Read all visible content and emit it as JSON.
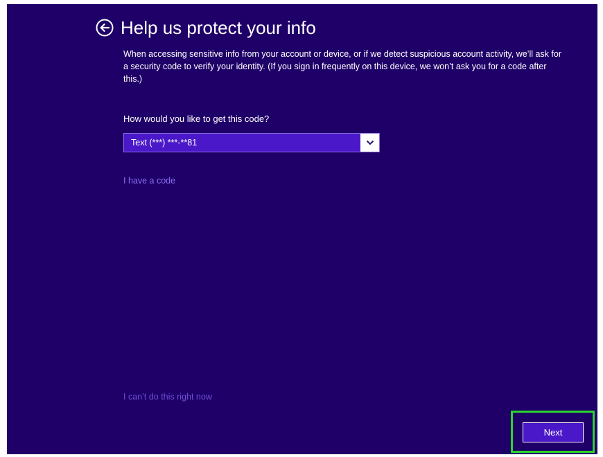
{
  "header": {
    "back_icon": "back-arrow-circle-icon",
    "title": "Help us protect your info"
  },
  "description": "When accessing sensitive info from your account or device, or if we detect suspicious account activity, we’ll ask for a security code to verify your identity. (If you sign in frequently on this device, we won’t ask you for a code after this.)",
  "code_method": {
    "label": "How would you like to get this code?",
    "selected": "Text (***) ***-**81",
    "arrow_icon": "chevron-down-icon"
  },
  "links": {
    "have_code": "I have a code",
    "cant_do": "I can’t do this right now"
  },
  "footer": {
    "next_label": "Next"
  },
  "colors": {
    "background": "#1f0068",
    "accent": "#4a18c8",
    "link": "#8b6ff0",
    "highlight": "#2bd42b"
  }
}
